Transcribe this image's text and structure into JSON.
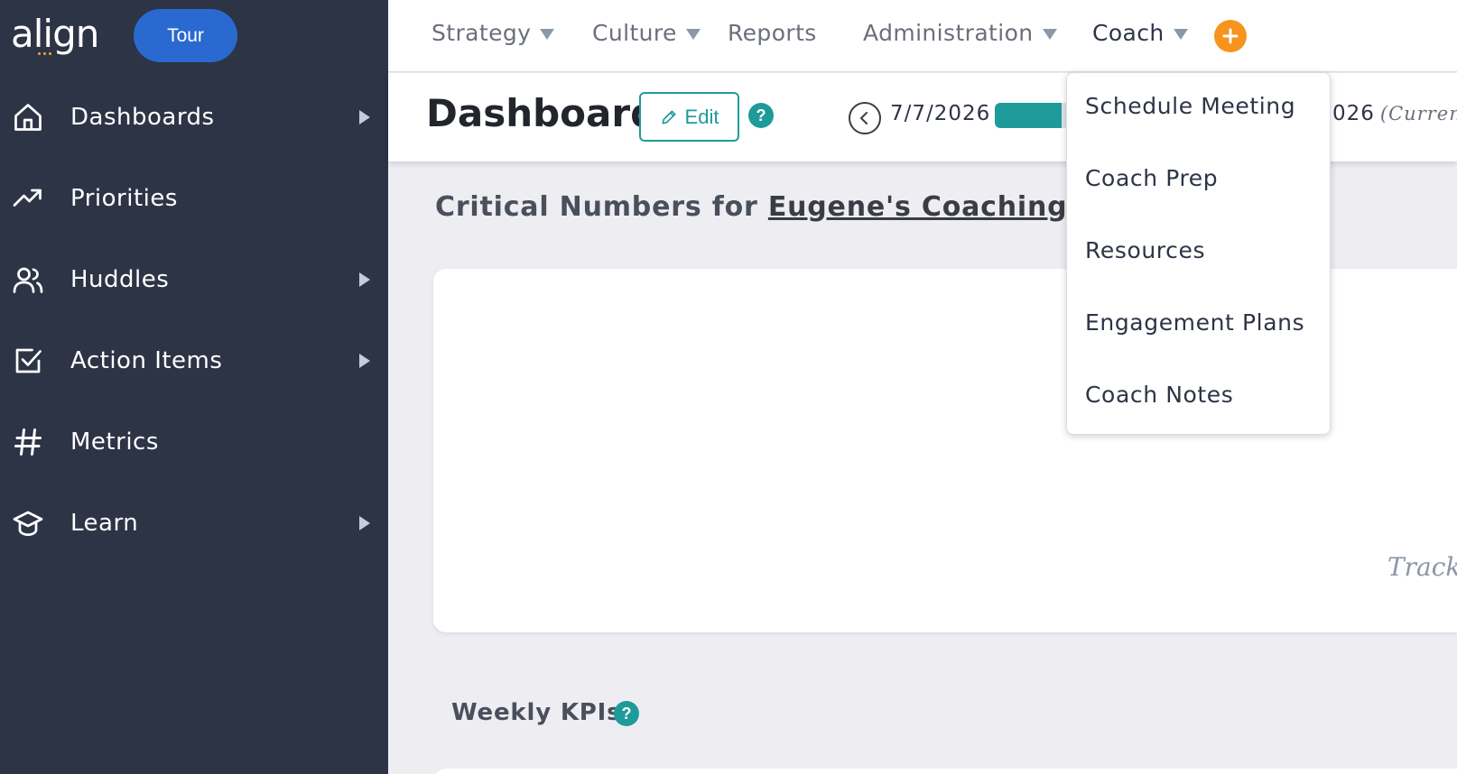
{
  "brand": {
    "logo_text": "align"
  },
  "tour_button": {
    "label": "Tour"
  },
  "sidebar": {
    "items": [
      {
        "label": "Dashboards",
        "icon": "home-icon",
        "has_submenu": true
      },
      {
        "label": "Priorities",
        "icon": "trending-up-icon",
        "has_submenu": false
      },
      {
        "label": "Huddles",
        "icon": "users-icon",
        "has_submenu": true
      },
      {
        "label": "Action Items",
        "icon": "checkbox-icon",
        "has_submenu": true
      },
      {
        "label": "Metrics",
        "icon": "hash-icon",
        "has_submenu": false
      },
      {
        "label": "Learn",
        "icon": "graduation-cap-icon",
        "has_submenu": true
      }
    ]
  },
  "topnav": {
    "items": [
      {
        "label": "Strategy",
        "has_dropdown": true
      },
      {
        "label": "Culture",
        "has_dropdown": true
      },
      {
        "label": "Reports",
        "has_dropdown": false
      },
      {
        "label": "Administration",
        "has_dropdown": true
      },
      {
        "label": "Coach",
        "has_dropdown": true,
        "active": true
      }
    ],
    "add_icon": "plus-circle-icon"
  },
  "header": {
    "title": "Dashboard",
    "edit_label": "Edit",
    "help_glyph": "?",
    "date_start": "7/7/2026",
    "date_end": "026",
    "date_end_note": "(Current)",
    "period_progress": 0.62
  },
  "critical": {
    "prefix": "Critical Numbers for ",
    "company": "Eugene's Coaching Com"
  },
  "card": {
    "track_text": "Track"
  },
  "weekly": {
    "title": "Weekly KPIs"
  },
  "coach_menu": {
    "items": [
      {
        "label": "Schedule Meeting"
      },
      {
        "label": "Coach Prep"
      },
      {
        "label": "Resources"
      },
      {
        "label": "Engagement Plans"
      },
      {
        "label": "Coach Notes"
      }
    ]
  },
  "colors": {
    "sidebar_bg": "#2d3446",
    "accent_teal": "#1f9a9a",
    "tour_blue": "#2a69d0",
    "add_orange": "#f7941d"
  }
}
